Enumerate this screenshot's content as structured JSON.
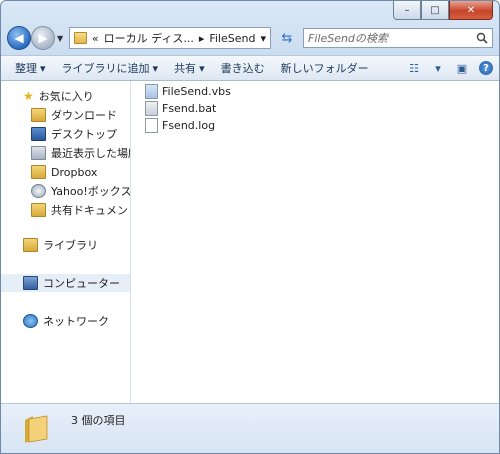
{
  "window": {
    "controls": {
      "minimize": "–",
      "maximize": "□",
      "close": "✕"
    }
  },
  "address_bar": {
    "chevrons": "«",
    "crumb1": "ローカル ディス...",
    "separator": "▸",
    "crumb2": "FileSend",
    "dropdown": "▾"
  },
  "search": {
    "placeholder": "FileSendの検索",
    "icon": "search-icon"
  },
  "toolbar": {
    "organize": "整理",
    "add_to_library": "ライブラリに追加",
    "share": "共有",
    "burn": "書き込む",
    "new_folder": "新しいフォルダー",
    "dropdown_arrow": "▾"
  },
  "navigation": {
    "favorites_header": "お気に入り",
    "favorites": [
      {
        "label": "ダウンロード",
        "icon": "download-folder-icon"
      },
      {
        "label": "デスクトップ",
        "icon": "desktop-icon"
      },
      {
        "label": "最近表示した場所",
        "icon": "recent-places-icon"
      },
      {
        "label": "Dropbox",
        "icon": "dropbox-folder-icon"
      },
      {
        "label": "Yahoo!ボックス",
        "icon": "yahoo-box-icon"
      },
      {
        "label": "共有ドキュメント (",
        "icon": "shared-docs-icon"
      }
    ],
    "libraries": "ライブラリ",
    "computer": "コンピューター",
    "network": "ネットワーク"
  },
  "files": [
    {
      "name": "FileSend.vbs",
      "type": "vbs"
    },
    {
      "name": "Fsend.bat",
      "type": "bat"
    },
    {
      "name": "Fsend.log",
      "type": "log"
    }
  ],
  "status": {
    "item_count": "3 個の項目"
  }
}
